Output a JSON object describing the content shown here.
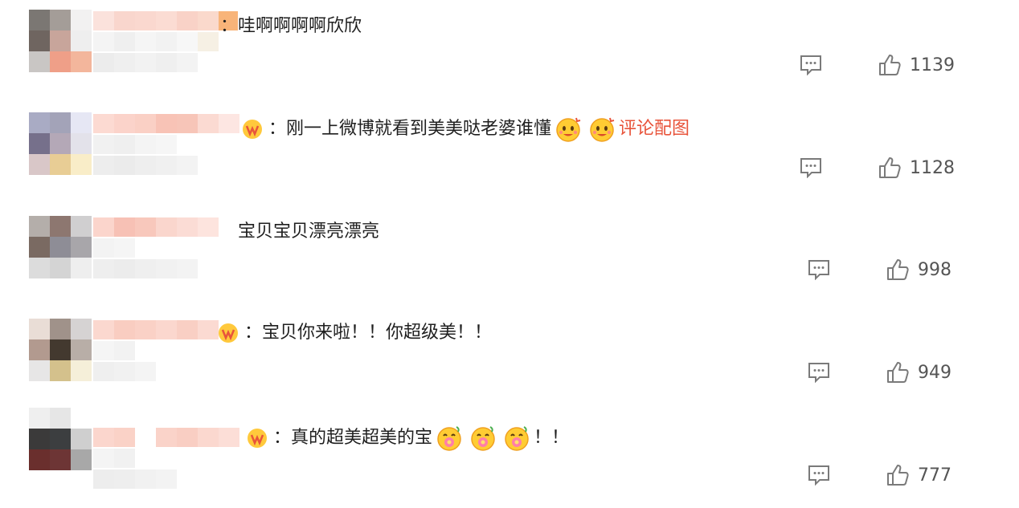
{
  "comments": [
    {
      "text": "：哇啊啊啊啊欣欣",
      "likes": "1139"
    },
    {
      "text": "：刚一上微博就看到美美哒老婆谁懂",
      "tag": "评论配图",
      "likes": "1128"
    },
    {
      "text": "宝贝宝贝漂亮漂亮",
      "likes": "998"
    },
    {
      "text": "：宝贝你来啦！！你超级美！！",
      "likes": "949"
    },
    {
      "text": "：真的超美超美的宝",
      "suffix": "！！",
      "likes": "777"
    }
  ],
  "icons": {
    "reply": "comment-icon",
    "like": "thumbs-up-icon",
    "emoji": "emoji-icon",
    "badge": "vip-badge-icon"
  },
  "colors": {
    "accent": "#e8543b",
    "text": "#1f1f1f",
    "meta": "#555555",
    "icon": "#7a7a7a"
  }
}
